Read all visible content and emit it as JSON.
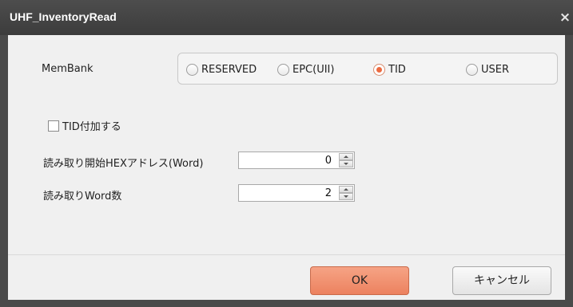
{
  "window": {
    "title": "UHF_InventoryRead",
    "close_glyph": "×",
    "close_icon": "close-icon"
  },
  "membank": {
    "label": "MemBank",
    "options": [
      {
        "label": "RESERVED",
        "selected": false
      },
      {
        "label": "EPC(UII)",
        "selected": false
      },
      {
        "label": "TID",
        "selected": true
      },
      {
        "label": "USER",
        "selected": false
      }
    ]
  },
  "tid_append": {
    "label": "TID付加する",
    "checked": false
  },
  "start_address": {
    "label": "読み取り開始HEXアドレス(Word)",
    "value": "0"
  },
  "word_count": {
    "label": "読み取りWord数",
    "value": "2"
  },
  "buttons": {
    "ok": "OK",
    "cancel": "キャンセル"
  },
  "colors": {
    "accent": "#ec825f",
    "titlebar": "#3c3c3c",
    "panel": "#f0f0f0"
  }
}
